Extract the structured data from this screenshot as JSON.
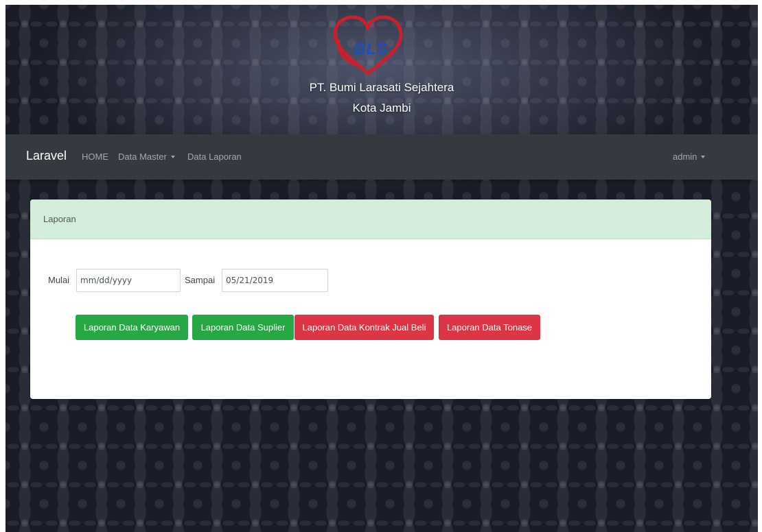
{
  "banner": {
    "logo_text": "BLS",
    "company_name": "PT. Bumi Larasati Sejahtera",
    "city": "Kota Jambi"
  },
  "navbar": {
    "brand": "Laravel",
    "items": [
      {
        "label": "HOME"
      },
      {
        "label": "Data Master",
        "has_dropdown": true
      },
      {
        "label": "Data Laporan"
      }
    ],
    "user": {
      "label": "admin",
      "has_dropdown": true
    }
  },
  "card": {
    "title": "Laporan",
    "start_label": "Mulai",
    "start_value": "mm/dd/yyyy",
    "end_label": "Sampai",
    "end_value": "05/21/2019",
    "buttons": [
      {
        "label": "Laporan Data Karyawan",
        "color": "#28a745"
      },
      {
        "label": "Laporan Data Suplier",
        "color": "#28a745"
      },
      {
        "label": "Laporan Data Kontrak Jual Beli",
        "color": "#dc3545"
      },
      {
        "label": "Laporan Data Tonase",
        "color": "#dc3545"
      }
    ]
  },
  "colors": {
    "navbar": "#343a40",
    "card_header": "#d4edda",
    "logo_heart": "#c8202f",
    "logo_text": "#1e4fb4"
  }
}
